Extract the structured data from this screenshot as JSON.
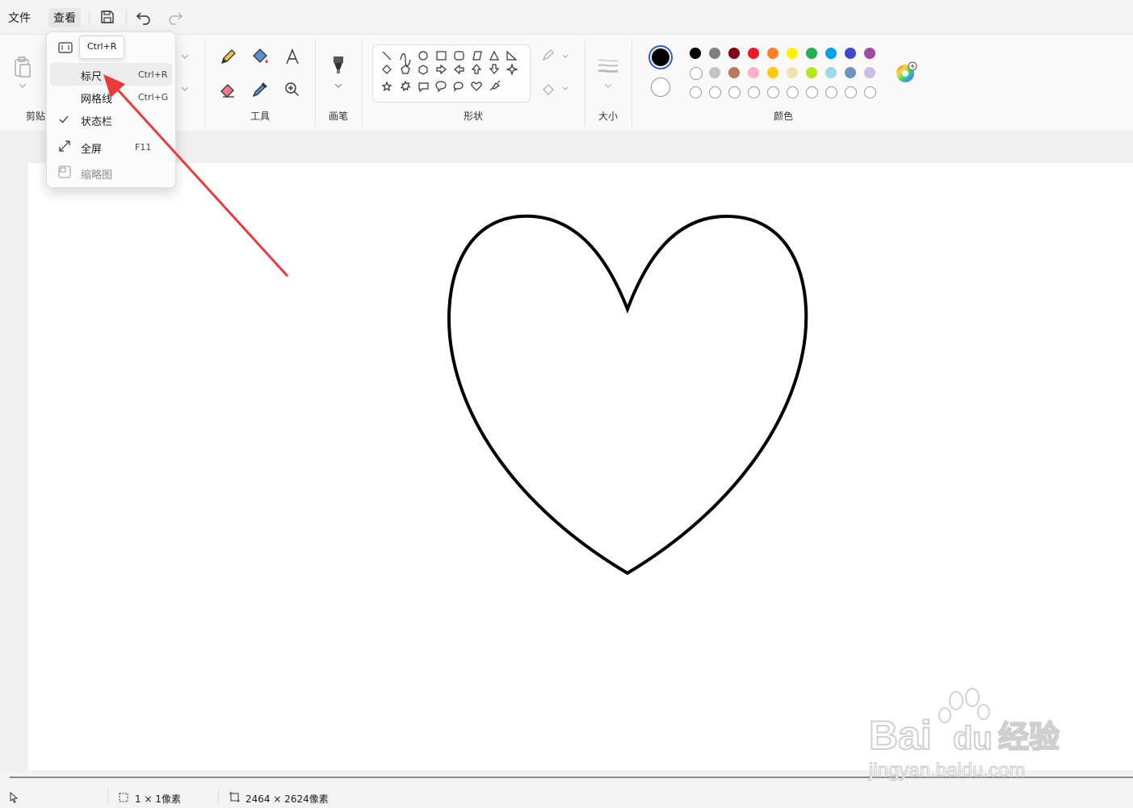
{
  "menubar": {
    "file_label": "文件",
    "view_label": "查看"
  },
  "ribbon": {
    "groups": {
      "clipboard": "剪贴",
      "tools": "工具",
      "brushes": "画笔",
      "shapes": "形状",
      "size": "大小",
      "colors": "颜色"
    },
    "primary_color": "#000000",
    "secondary_color": "#ffffff",
    "palette_row1": [
      "#000000",
      "#7f7f7f",
      "#880015",
      "#ed1c24",
      "#ff7f27",
      "#fff200",
      "#22b14c",
      "#00a2e8",
      "#3f48cc",
      "#a349a4"
    ],
    "palette_row2": [
      "#ffffff",
      "#c3c3c3",
      "#b97a57",
      "#ffaec9",
      "#ffc90e",
      "#efe4b0",
      "#b5e61d",
      "#99d9ea",
      "#7092be",
      "#c8bfe7"
    ],
    "palette_row3": [
      "empty",
      "empty",
      "empty",
      "empty",
      "empty",
      "empty",
      "empty",
      "empty",
      "empty",
      "empty"
    ]
  },
  "view_menu": {
    "items": [
      {
        "label": "标尺",
        "shortcut": "Ctrl+R",
        "checked": false
      },
      {
        "label": "网格线",
        "shortcut": "Ctrl+G",
        "checked": false
      },
      {
        "label": "状态栏",
        "shortcut": "",
        "checked": true
      },
      {
        "label": "全屏",
        "shortcut": "F11",
        "checked": false
      },
      {
        "label": "缩略图",
        "shortcut": "",
        "checked": false,
        "disabled": true
      }
    ],
    "tooltip": "Ctrl+R"
  },
  "statusbar": {
    "selection_size": "1 × 1像素",
    "canvas_size": "2464 × 2624像素"
  },
  "annotation": {
    "arrow_color": "#ea3a3a"
  },
  "watermark": {
    "brand": "Bai",
    "brand_suffix": "du",
    "cn": "经验",
    "url": "jingyan.baidu.com"
  }
}
